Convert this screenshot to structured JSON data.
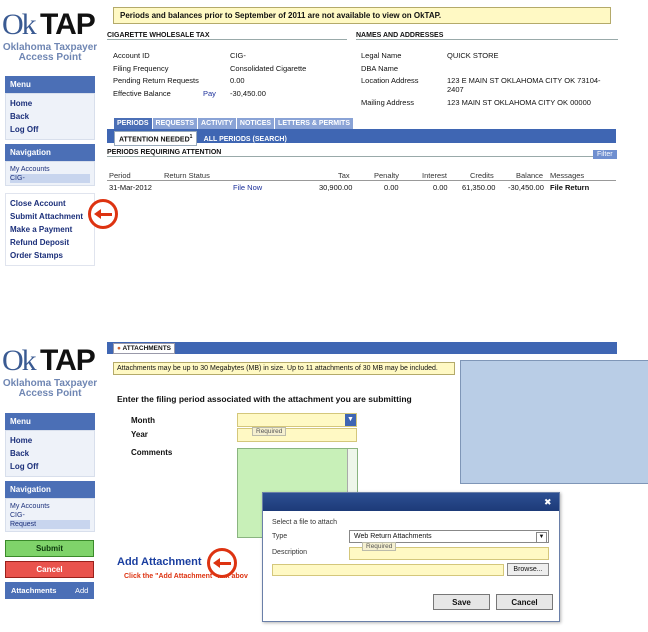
{
  "logo": {
    "ok": "Ok",
    "tap": "TAP",
    "line1": "Oklahoma Taxpayer",
    "line2": "Access Point"
  },
  "top": {
    "banner": "Periods and balances prior to September of 2011 are not available to view on OkTAP.",
    "menu": {
      "title": "Menu",
      "items": [
        "Home",
        "Back",
        "Log Off"
      ]
    },
    "navigation": {
      "title": "Navigation",
      "my_accounts": "My Accounts",
      "account": "CIG-"
    },
    "actions": [
      "Close Account",
      "Submit Attachment",
      "Make a Payment",
      "Refund Deposit",
      "Order Stamps"
    ],
    "account_section": {
      "title": "CIGARETTE WHOLESALE TAX",
      "rows": [
        {
          "label": "Account ID",
          "value": "CIG-"
        },
        {
          "label": "Filing Frequency",
          "value": "Consolidated Cigarette"
        },
        {
          "label": "Pending Return Requests",
          "value": "0.00"
        },
        {
          "label": "Effective Balance",
          "link": "Pay",
          "value": "-30,450.00"
        }
      ]
    },
    "names_section": {
      "title": "NAMES AND ADDRESSES",
      "rows": [
        {
          "label": "Legal Name",
          "value": "QUICK STORE"
        },
        {
          "label": "DBA Name",
          "value": ""
        },
        {
          "label": "Location Address",
          "value": "123 E MAIN ST OKLAHOMA CITY OK 73104-",
          "value2": "2407"
        },
        {
          "label": "Mailing Address",
          "value": "123 MAIN ST OKLAHOMA CITY OK 00000"
        }
      ]
    },
    "tabs": [
      "PERIODS",
      "REQUESTS",
      "ACTIVITY",
      "NOTICES",
      "LETTERS & PERMITS"
    ],
    "subtabs": [
      "ATTENTION NEEDED",
      "ALL PERIODS (SEARCH)"
    ],
    "subtab_badge": "1",
    "periods_title": "PERIODS REQUIRING ATTENTION",
    "filter": "Filter",
    "columns": [
      "Period",
      "Return Status",
      "Tax",
      "Penalty",
      "Interest",
      "Credits",
      "Balance",
      "Messages"
    ],
    "row": {
      "period": "31-Mar-2012",
      "status_link": "File Now",
      "tax": "30,900.00",
      "penalty": "0.00",
      "interest": "0.00",
      "credits": "61,350.00",
      "balance": "-30,450.00",
      "messages": "File Return"
    }
  },
  "bottom": {
    "menu": {
      "title": "Menu",
      "items": [
        "Home",
        "Back",
        "Log Off"
      ]
    },
    "navigation": {
      "title": "Navigation",
      "my_accounts": "My Accounts",
      "account": "CIG-",
      "request": "Request"
    },
    "submit": "Submit",
    "cancel": "Cancel",
    "attachments_label": "Attachments",
    "attachments_add": "Add",
    "panel_title": "ATTACHMENTS",
    "banner": "Attachments may be up to 30 Megabytes (MB) in size. Up to 11 attachments of 30 MB may be included.",
    "instruction": "Enter the filing period associated with the attachment you are submitting",
    "month_label": "Month",
    "year_label": "Year",
    "comments_label": "Comments",
    "required": "Required",
    "add_attachment": "Add Attachment",
    "hint": "Click the \"Add Attachment\" link abov",
    "dialog": {
      "close": "✖",
      "select_label": "Select a file to attach",
      "type_label": "Type",
      "type_value": "Web Return Attachments",
      "description_label": "Description",
      "required": "Required",
      "browse": "Browse...",
      "save": "Save",
      "cancel": "Cancel"
    }
  },
  "colors": {
    "nav_blue": "#4b6fb6",
    "tab_blue": "#3f66b3",
    "banner_yellow": "#fff9c4",
    "arrow_red": "#dd3311",
    "submit_green": "#7fd36a",
    "cancel_red": "#e9534d"
  }
}
